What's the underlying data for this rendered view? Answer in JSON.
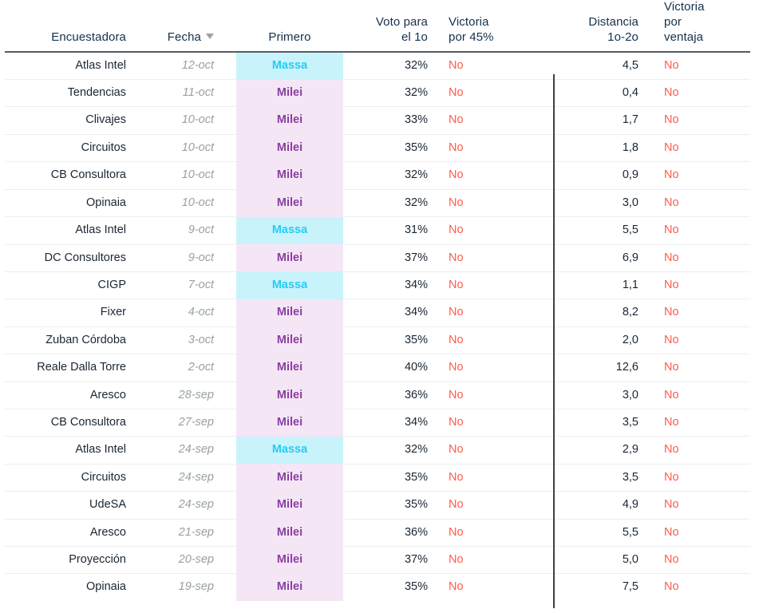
{
  "table": {
    "columns": [
      {
        "key": "encuestadora",
        "label": "Encuestadora",
        "align": "right",
        "sorted": false
      },
      {
        "key": "fecha",
        "label": "Fecha",
        "align": "right",
        "sorted": true,
        "sort_direction": "descending",
        "sort_icon": "triangle-down-icon"
      },
      {
        "key": "primero",
        "label": "Primero",
        "align": "center",
        "sorted": false
      },
      {
        "key": "voto_1o",
        "label": "Voto para el 1o",
        "align": "right",
        "sorted": false
      },
      {
        "key": "victoria_45",
        "label": "Victoria por 45%",
        "align": "left",
        "sorted": false
      },
      {
        "key": "distancia",
        "label": "Distancia 1o-2o",
        "align": "right",
        "sorted": false
      },
      {
        "key": "victoria_ventaja",
        "label": "Victoria por ventaja",
        "align": "left",
        "sorted": false
      }
    ],
    "header_lines": {
      "encuestadora": [
        "Encuestadora"
      ],
      "fecha": [
        "Fecha"
      ],
      "primero": [
        "Primero"
      ],
      "voto_1o": [
        "Voto para",
        "el 1o"
      ],
      "victoria_45": [
        "Victoria",
        "por 45%"
      ],
      "distancia": [
        "Distancia",
        "1o-2o"
      ],
      "victoria_ventaja": [
        "Victoria",
        "por",
        "ventaja"
      ]
    },
    "colors": {
      "massa_background": "#c9f3fb",
      "massa_text": "#24cdf4",
      "milei_background": "#f5e6f6",
      "milei_text": "#8a3fa0",
      "no_text": "#ff5a4d",
      "date_text": "#97a0a6",
      "header_text": "#14304d",
      "header_rule": "#555c63",
      "row_rule": "#eceef0",
      "group_divider": "#3a4249"
    },
    "rows": [
      {
        "encuestadora": "Atlas Intel",
        "fecha": "12-oct",
        "primero": "Massa",
        "voto_1o": "32%",
        "victoria_45": "No",
        "distancia": "4,5",
        "victoria_ventaja": "No"
      },
      {
        "encuestadora": "Tendencias",
        "fecha": "11-oct",
        "primero": "Milei",
        "voto_1o": "32%",
        "victoria_45": "No",
        "distancia": "0,4",
        "victoria_ventaja": "No"
      },
      {
        "encuestadora": "Clivajes",
        "fecha": "10-oct",
        "primero": "Milei",
        "voto_1o": "33%",
        "victoria_45": "No",
        "distancia": "1,7",
        "victoria_ventaja": "No"
      },
      {
        "encuestadora": "Circuitos",
        "fecha": "10-oct",
        "primero": "Milei",
        "voto_1o": "35%",
        "victoria_45": "No",
        "distancia": "1,8",
        "victoria_ventaja": "No"
      },
      {
        "encuestadora": "CB Consultora",
        "fecha": "10-oct",
        "primero": "Milei",
        "voto_1o": "32%",
        "victoria_45": "No",
        "distancia": "0,9",
        "victoria_ventaja": "No"
      },
      {
        "encuestadora": "Opinaia",
        "fecha": "10-oct",
        "primero": "Milei",
        "voto_1o": "32%",
        "victoria_45": "No",
        "distancia": "3,0",
        "victoria_ventaja": "No"
      },
      {
        "encuestadora": "Atlas Intel",
        "fecha": "9-oct",
        "primero": "Massa",
        "voto_1o": "31%",
        "victoria_45": "No",
        "distancia": "5,5",
        "victoria_ventaja": "No"
      },
      {
        "encuestadora": "DC Consultores",
        "fecha": "9-oct",
        "primero": "Milei",
        "voto_1o": "37%",
        "victoria_45": "No",
        "distancia": "6,9",
        "victoria_ventaja": "No"
      },
      {
        "encuestadora": "CIGP",
        "fecha": "7-oct",
        "primero": "Massa",
        "voto_1o": "34%",
        "victoria_45": "No",
        "distancia": "1,1",
        "victoria_ventaja": "No"
      },
      {
        "encuestadora": "Fixer",
        "fecha": "4-oct",
        "primero": "Milei",
        "voto_1o": "34%",
        "victoria_45": "No",
        "distancia": "8,2",
        "victoria_ventaja": "No"
      },
      {
        "encuestadora": "Zuban Córdoba",
        "fecha": "3-oct",
        "primero": "Milei",
        "voto_1o": "35%",
        "victoria_45": "No",
        "distancia": "2,0",
        "victoria_ventaja": "No"
      },
      {
        "encuestadora": "Reale Dalla Torre",
        "fecha": "2-oct",
        "primero": "Milei",
        "voto_1o": "40%",
        "victoria_45": "No",
        "distancia": "12,6",
        "victoria_ventaja": "No"
      },
      {
        "encuestadora": "Aresco",
        "fecha": "28-sep",
        "primero": "Milei",
        "voto_1o": "36%",
        "victoria_45": "No",
        "distancia": "3,0",
        "victoria_ventaja": "No"
      },
      {
        "encuestadora": "CB Consultora",
        "fecha": "27-sep",
        "primero": "Milei",
        "voto_1o": "34%",
        "victoria_45": "No",
        "distancia": "3,5",
        "victoria_ventaja": "No"
      },
      {
        "encuestadora": "Atlas Intel",
        "fecha": "24-sep",
        "primero": "Massa",
        "voto_1o": "32%",
        "victoria_45": "No",
        "distancia": "2,9",
        "victoria_ventaja": "No"
      },
      {
        "encuestadora": "Circuitos",
        "fecha": "24-sep",
        "primero": "Milei",
        "voto_1o": "35%",
        "victoria_45": "No",
        "distancia": "3,5",
        "victoria_ventaja": "No"
      },
      {
        "encuestadora": "UdeSA",
        "fecha": "24-sep",
        "primero": "Milei",
        "voto_1o": "35%",
        "victoria_45": "No",
        "distancia": "4,9",
        "victoria_ventaja": "No"
      },
      {
        "encuestadora": "Aresco",
        "fecha": "21-sep",
        "primero": "Milei",
        "voto_1o": "36%",
        "victoria_45": "No",
        "distancia": "5,5",
        "victoria_ventaja": "No"
      },
      {
        "encuestadora": "Proyección",
        "fecha": "20-sep",
        "primero": "Milei",
        "voto_1o": "37%",
        "victoria_45": "No",
        "distancia": "5,0",
        "victoria_ventaja": "No"
      },
      {
        "encuestadora": "Opinaia",
        "fecha": "19-sep",
        "primero": "Milei",
        "voto_1o": "35%",
        "victoria_45": "No",
        "distancia": "7,5",
        "victoria_ventaja": "No"
      }
    ]
  }
}
